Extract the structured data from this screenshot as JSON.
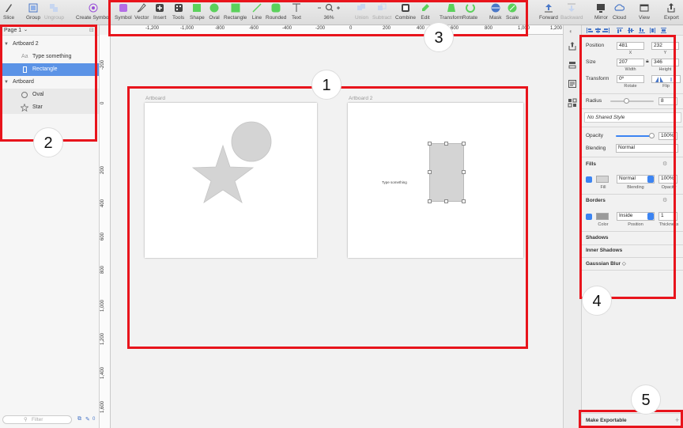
{
  "toolbar": {
    "items": [
      {
        "label": "Slice",
        "icon": "knife-icon"
      },
      {
        "label": "Group",
        "icon": "group-icon"
      },
      {
        "label": "Ungroup",
        "icon": "ungroup-icon",
        "disabled": true
      },
      {
        "label": "Create Symbol",
        "icon": "symbol-create-icon"
      },
      {
        "label": "Symbol",
        "icon": "symbol-icon"
      },
      {
        "label": "Vector",
        "icon": "pen-icon"
      },
      {
        "label": "Insert",
        "icon": "plus-icon"
      },
      {
        "label": "Tools",
        "icon": "tools-icon"
      },
      {
        "label": "Shape",
        "icon": "shape-icon"
      },
      {
        "label": "Oval",
        "icon": "oval-icon"
      },
      {
        "label": "Rectangle",
        "icon": "rectangle-icon"
      },
      {
        "label": "Line",
        "icon": "line-icon"
      },
      {
        "label": "Rounded",
        "icon": "rounded-rect-icon"
      },
      {
        "label": "Text",
        "icon": "text-icon"
      },
      {
        "label": "36%",
        "icon": "zoom-icon"
      },
      {
        "label": "Union",
        "icon": "union-icon",
        "disabled": true
      },
      {
        "label": "Subtract",
        "icon": "subtract-icon",
        "disabled": true
      },
      {
        "label": "Combine",
        "icon": "combine-icon"
      },
      {
        "label": "Edit",
        "icon": "edit-icon"
      },
      {
        "label": "Transform",
        "icon": "transform-icon"
      },
      {
        "label": "Rotate",
        "icon": "rotate-icon"
      },
      {
        "label": "Mask",
        "icon": "mask-icon"
      },
      {
        "label": "Scale",
        "icon": "scale-icon"
      },
      {
        "label": "Forward",
        "icon": "forward-icon"
      },
      {
        "label": "Backward",
        "icon": "backward-icon",
        "disabled": true
      },
      {
        "label": "Mirror",
        "icon": "mirror-icon"
      },
      {
        "label": "Cloud",
        "icon": "cloud-icon"
      },
      {
        "label": "View",
        "icon": "view-icon"
      },
      {
        "label": "Export",
        "icon": "export-icon"
      }
    ]
  },
  "ruler": {
    "top_ticks": [
      "-1,200",
      "-1,000",
      "-800",
      "-600",
      "-400",
      "-200",
      "0",
      "200",
      "400",
      "600",
      "800",
      "1,000",
      "1,200"
    ],
    "left_ticks": [
      "-200",
      "0",
      "200",
      "400",
      "600",
      "800",
      "1,000",
      "1,200",
      "1,400",
      "1,600",
      "1,800"
    ]
  },
  "layers": {
    "page": "Page 1",
    "rows": [
      {
        "label": "Artboard 2",
        "kind": "artboard"
      },
      {
        "label": "Type something",
        "kind": "text",
        "icon": "text-layer-icon"
      },
      {
        "label": "Rectangle",
        "kind": "shape",
        "icon": "rectangle-layer-icon",
        "selected": true
      },
      {
        "label": "Artboard",
        "kind": "artboard"
      },
      {
        "label": "Oval",
        "kind": "shape",
        "icon": "oval-layer-icon"
      },
      {
        "label": "Star",
        "kind": "shape",
        "icon": "star-layer-icon"
      }
    ],
    "filter_placeholder": "Filter",
    "footer_count": "0"
  },
  "canvas": {
    "artboard1_label": "Artboard",
    "artboard2_label": "Artboard 2",
    "text_layer": "Type something"
  },
  "inspector": {
    "position_label": "Position",
    "x_value": "481",
    "y_value": "232",
    "x_label": "X",
    "y_label": "Y",
    "size_label": "Size",
    "width_value": "207",
    "height_value": "346",
    "width_label": "Width",
    "height_label": "Height",
    "transform_label": "Transform",
    "rotate_value": "0º",
    "rotate_label": "Rotate",
    "flip_label": "Flip",
    "radius_label": "Radius",
    "radius_value": "8",
    "shared_style": "No Shared Style",
    "opacity_label": "Opacity",
    "opacity_value": "100%",
    "blending_label": "Blending",
    "blending_value": "Normal",
    "fills_title": "Fills",
    "fill_blend_value": "Normal",
    "fill_opacity_value": "100%",
    "fill_label": "Fill",
    "fill_blending_label": "Blending",
    "fill_opacity_label": "Opacity",
    "borders_title": "Borders",
    "border_position_value": "Inside",
    "border_thickness_value": "1",
    "border_color_label": "Color",
    "border_position_label": "Position",
    "border_thickness_label": "Thickness",
    "shadows_title": "Shadows",
    "inner_shadows_title": "Inner Shadows",
    "blur_title": "Gaussian Blur ◇",
    "make_exportable": "Make Exportable"
  },
  "callouts": [
    "1",
    "2",
    "3",
    "4",
    "5"
  ],
  "colors": {
    "highlight_red": "#e8141c",
    "selection_blue": "#5b93e6",
    "shape_gray": "#d4d4d4"
  }
}
